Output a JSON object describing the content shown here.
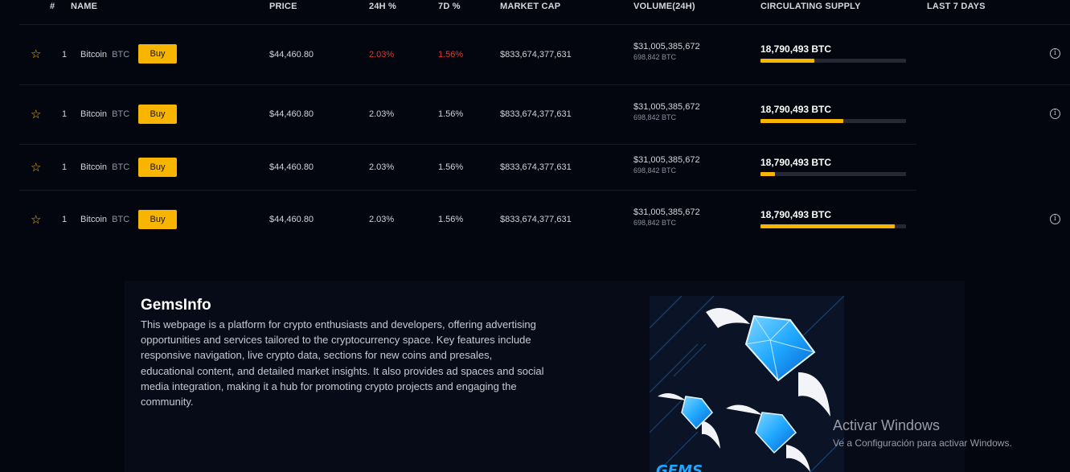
{
  "table": {
    "headers": {
      "rank": "#",
      "name": "NAME",
      "price": "PRICE",
      "change24h": "24H %",
      "change7d": "7D %",
      "market_cap": "MARKET CAP",
      "volume": "VOLUME(24H)",
      "supply": "CIRCULATING SUPPLY",
      "last7": "LAST 7 DAYS"
    },
    "rows": [
      {
        "rank": "1",
        "name": "Bitcoin",
        "symbol": "BTC",
        "buy_label": "Buy",
        "price": "$44,460.80",
        "change24h": "2.03%",
        "change7d": "1.56%",
        "market_cap": "$833,674,377,631",
        "volume": "$31,005,385,672",
        "volume_sub": "698,842 BTC",
        "supply": "18,790,493 BTC",
        "supply_progress": 0.37
      },
      {
        "rank": "1",
        "name": "Bitcoin",
        "symbol": "BTC",
        "buy_label": "Buy",
        "price": "$44,460.80",
        "change24h": "2.03%",
        "change7d": "1.56%",
        "market_cap": "$833,674,377,631",
        "volume": "$31,005,385,672",
        "volume_sub": "698,842 BTC",
        "supply": "18,790,493 BTC",
        "supply_progress": 0.57
      },
      {
        "rank": "1",
        "name": "Bitcoin",
        "symbol": "BTC",
        "buy_label": "Buy",
        "price": "$44,460.80",
        "change24h": "2.03%",
        "change7d": "1.56%",
        "market_cap": "$833,674,377,631",
        "volume": "$31,005,385,672",
        "volume_sub": "698,842 BTC",
        "supply": "18,790,493 BTC",
        "supply_progress": 0.1
      },
      {
        "rank": "1",
        "name": "Bitcoin",
        "symbol": "BTC",
        "buy_label": "Buy",
        "price": "$44,460.80",
        "change24h": "2.03%",
        "change7d": "1.56%",
        "market_cap": "$833,674,377,631",
        "volume": "$31,005,385,672",
        "volume_sub": "698,842 BTC",
        "supply": "18,790,493 BTC",
        "supply_progress": 0.92
      }
    ]
  },
  "info_card": {
    "title": "GemsInfo",
    "description": "This webpage is a platform for crypto enthusiasts and developers, offering advertising opportunities and services tailored to the cryptocurrency space. Key features include responsive navigation, live crypto data, sections for new coins and presales, educational content, and detailed market insights. It also provides ad spaces and social media integration, making it a hub for promoting crypto projects and engaging the community."
  },
  "artwork": {
    "logo_text": "GEMS"
  },
  "watermark": {
    "title": "Activar Windows",
    "subtitle": "Ve a Configuración para activar Windows."
  },
  "colors": {
    "background": "#03060f",
    "accent": "#f7b500",
    "negative": "#e2372d",
    "gem": "#1ea7ff"
  },
  "icons": {
    "favorite": "star-outline-icon",
    "info": "info-circle-icon"
  }
}
